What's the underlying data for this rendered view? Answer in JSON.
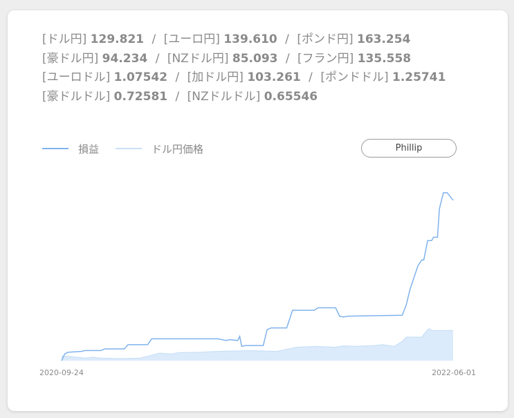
{
  "rates": [
    {
      "label": "[ドル円]",
      "value": "129.821"
    },
    {
      "label": "[ユーロ円]",
      "value": "139.610"
    },
    {
      "label": "[ポンド円]",
      "value": "163.254"
    },
    {
      "label": "[豪ドル円]",
      "value": "94.234"
    },
    {
      "label": "[NZドル円]",
      "value": "85.093"
    },
    {
      "label": "[フラン円]",
      "value": "135.558"
    },
    {
      "label": "[ユーロドル]",
      "value": "1.07542"
    },
    {
      "label": "[加ドル円]",
      "value": "103.261"
    },
    {
      "label": "[ポンドドル]",
      "value": "1.25741"
    },
    {
      "label": "[豪ドルドル]",
      "value": "0.72581"
    },
    {
      "label": "[NZドルドル]",
      "value": "0.65546"
    }
  ],
  "separator": "/",
  "legend": {
    "pnl_label": "損益",
    "price_label": "ドル円価格"
  },
  "phillip_button_label": "Phillip",
  "colors": {
    "pnl_line": "#7fb2ec",
    "price_line": "#c9e0f7",
    "price_fill": "#dcebfb",
    "text": "#8a8a8a"
  },
  "chart_data": {
    "type": "line",
    "x_start": "2020-09-24",
    "x_end": "2022-06-01",
    "x_tick_labels": [
      "2020-09-24",
      "2022-06-01"
    ],
    "y_axis_visible": false,
    "grid": false,
    "ylim": [
      0,
      100
    ],
    "series": [
      {
        "name": "損益",
        "x": [
          0,
          0.008,
          0.016,
          0.05,
          0.06,
          0.1,
          0.11,
          0.16,
          0.17,
          0.22,
          0.23,
          0.4,
          0.42,
          0.43,
          0.45,
          0.455,
          0.46,
          0.47,
          0.48,
          0.515,
          0.525,
          0.535,
          0.545,
          0.575,
          0.59,
          0.6,
          0.645,
          0.655,
          0.7,
          0.71,
          0.72,
          0.73,
          0.86,
          0.87,
          0.88,
          0.89,
          0.9,
          0.91,
          0.92,
          0.925,
          0.935,
          0.945,
          0.95,
          0.96,
          0.965,
          0.975,
          0.985,
          1.0
        ],
        "y": [
          0,
          4,
          5,
          5.5,
          6,
          6,
          7,
          7,
          9.5,
          9.5,
          13,
          13,
          12,
          12.5,
          12,
          14.5,
          8.5,
          9,
          9,
          9,
          18.5,
          19.5,
          19.5,
          19.5,
          30,
          30,
          30,
          31.5,
          31.5,
          26.5,
          26,
          26.5,
          27,
          27,
          33,
          42.5,
          49.5,
          56.5,
          60,
          60,
          71.5,
          71.5,
          73.5,
          73.5,
          90.5,
          100,
          100,
          95.5
        ]
      },
      {
        "name": "ドル円価格",
        "x": [
          0,
          0.02,
          0.06,
          0.08,
          0.1,
          0.15,
          0.2,
          0.25,
          0.28,
          0.3,
          0.35,
          0.4,
          0.45,
          0.48,
          0.5,
          0.55,
          0.6,
          0.65,
          0.7,
          0.72,
          0.75,
          0.8,
          0.82,
          0.85,
          0.87,
          0.88,
          0.9,
          0.92,
          0.935,
          0.94,
          0.945,
          0.96,
          1.0
        ],
        "y": [
          2.5,
          2.5,
          1.5,
          2,
          1.5,
          1.2,
          1.5,
          4.5,
          4,
          4.8,
          5,
          5.5,
          5.8,
          6,
          5.8,
          5.5,
          8,
          8.5,
          8,
          8.8,
          8.5,
          9,
          9.5,
          8.5,
          11.5,
          14,
          14,
          14,
          18.5,
          19,
          18,
          18,
          18
        ]
      }
    ]
  }
}
